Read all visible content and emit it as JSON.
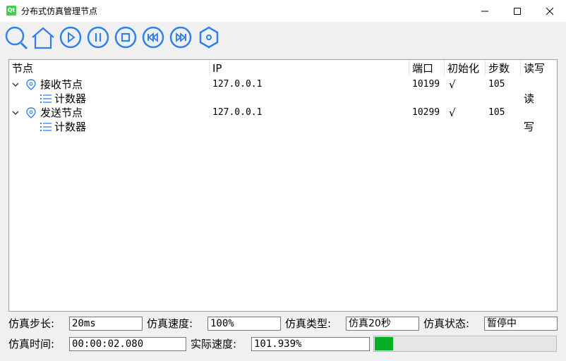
{
  "window": {
    "title": "分布式仿真管理节点",
    "logo_text": "Qt"
  },
  "toolbar": {
    "buttons": [
      "search-icon",
      "home-icon",
      "play-icon",
      "pause-icon",
      "stop-icon",
      "rewind-icon",
      "fast-forward-icon",
      "settings-icon"
    ],
    "accent": "#2f80ed"
  },
  "tree": {
    "headers": [
      "节点",
      "IP",
      "端口",
      "初始化",
      "步数",
      "读写"
    ],
    "rows": [
      {
        "name": "接收节点",
        "ip": "127.0.0.1",
        "port": "10199",
        "init": "√",
        "steps": "105",
        "rw": ""
      },
      {
        "name": "计数器",
        "ip": "",
        "port": "",
        "init": "",
        "steps": "",
        "rw": "读"
      },
      {
        "name": "发送节点",
        "ip": "127.0.0.1",
        "port": "10299",
        "init": "√",
        "steps": "105",
        "rw": ""
      },
      {
        "name": "计数器",
        "ip": "",
        "port": "",
        "init": "",
        "steps": "",
        "rw": "写"
      }
    ]
  },
  "status": {
    "step_label": "仿真步长:",
    "step_value": "20ms",
    "speed_label": "仿真速度:",
    "speed_value": "100%",
    "type_label": "仿真类型:",
    "type_value": "仿真20秒",
    "state_label": "仿真状态:",
    "state_value": "暂停中",
    "time_label": "仿真时间:",
    "time_value": "00:00:02.080",
    "actual_speed_label": "实际速度:",
    "actual_speed_value": "101.939%",
    "progress_fraction": 0.1,
    "progress_color": "#06b025"
  }
}
